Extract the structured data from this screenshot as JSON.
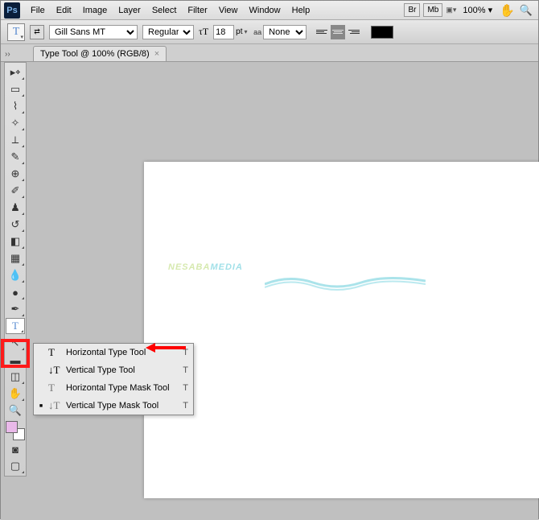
{
  "menu": {
    "items": [
      "File",
      "Edit",
      "Image",
      "Layer",
      "Select",
      "Filter",
      "View",
      "Window",
      "Help"
    ],
    "br": "Br",
    "mb": "Mb",
    "zoom": "100%"
  },
  "options": {
    "font": "Gill Sans MT",
    "style": "Regular",
    "size_val": "18",
    "size_unit": "pt",
    "aa_label": "aa",
    "aa_value": "None"
  },
  "tab": {
    "title": "Type Tool @ 100% (RGB/8)"
  },
  "watermark": {
    "part1": "NESABA",
    "part2": "MEDIA"
  },
  "flyout": [
    {
      "label": "Horizontal Type Tool",
      "shortcut": "T",
      "sel": false,
      "icon": "T"
    },
    {
      "label": "Vertical Type Tool",
      "shortcut": "T",
      "sel": false,
      "icon": "↓T"
    },
    {
      "label": "Horizontal Type Mask Tool",
      "shortcut": "T",
      "sel": false,
      "icon": "T"
    },
    {
      "label": "Vertical Type Mask Tool",
      "shortcut": "T",
      "sel": true,
      "icon": "↓T"
    }
  ],
  "tools": [
    "move",
    "marquee",
    "lasso",
    "wand",
    "crop",
    "eyedrop",
    "heal",
    "brush",
    "stamp",
    "history",
    "eraser",
    "gradient",
    "blur",
    "dodge",
    "pen",
    "type",
    "path",
    "shape",
    "3d",
    "hand",
    "zoom"
  ]
}
